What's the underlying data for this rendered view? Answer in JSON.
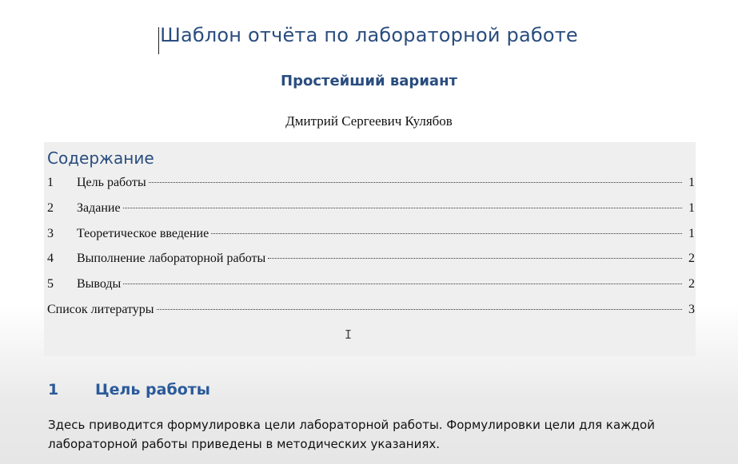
{
  "document": {
    "title": "Шаблон отчёта по лабораторной работе",
    "subtitle": "Простейший вариант",
    "author": "Дмитрий Сергеевич Кулябов"
  },
  "toc": {
    "heading": "Содержание",
    "items": [
      {
        "number": "1",
        "label": "Цель работы",
        "page": "1"
      },
      {
        "number": "2",
        "label": "Задание",
        "page": "1"
      },
      {
        "number": "3",
        "label": "Теоретическое введение",
        "page": "1"
      },
      {
        "number": "4",
        "label": "Выполнение лабораторной работы",
        "page": "2"
      },
      {
        "number": "5",
        "label": "Выводы",
        "page": "2"
      },
      {
        "number": "",
        "label": "Список литературы",
        "page": "3"
      }
    ]
  },
  "section": {
    "number": "1",
    "title": "Цель работы",
    "body": "Здесь приводится формулировка цели лабораторной работы. Формулировки цели для каждой лабораторной работы приведены в методических указаниях."
  },
  "colors": {
    "heading_blue": "#2a4d7f",
    "section_blue": "#2a5a9a",
    "toc_background": "#efefef"
  },
  "cursor": {
    "icon": "text-cursor-icon",
    "glyph": "I"
  }
}
